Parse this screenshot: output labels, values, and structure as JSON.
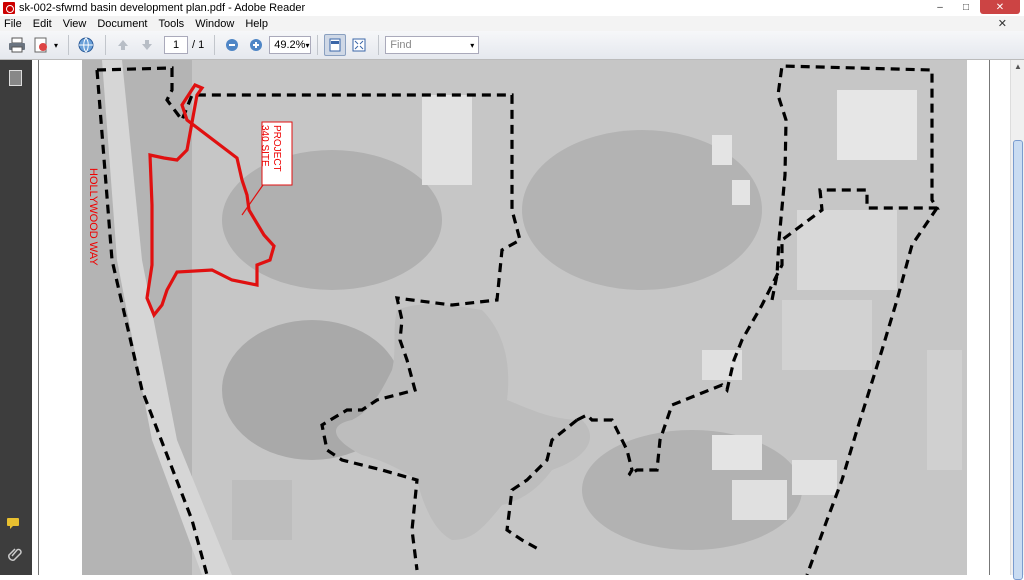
{
  "window": {
    "title": "sk-002-sfwmd basin development plan.pdf - Adobe Reader",
    "minimize": "–",
    "maximize": "□",
    "close": "✕"
  },
  "menu": {
    "items": [
      "File",
      "Edit",
      "View",
      "Document",
      "Tools",
      "Window",
      "Help"
    ],
    "close_glyph": "✕"
  },
  "toolbar": {
    "page_current": "1",
    "page_total": "/ 1",
    "zoom": "49.2%",
    "find_placeholder": "Find"
  },
  "map": {
    "label_road": "HOLLYWOOD WAY",
    "label_project_line1": "PROJECT",
    "label_project_line2": "340 SITE",
    "boundary_color": "#000000",
    "site_color": "#e01010"
  }
}
